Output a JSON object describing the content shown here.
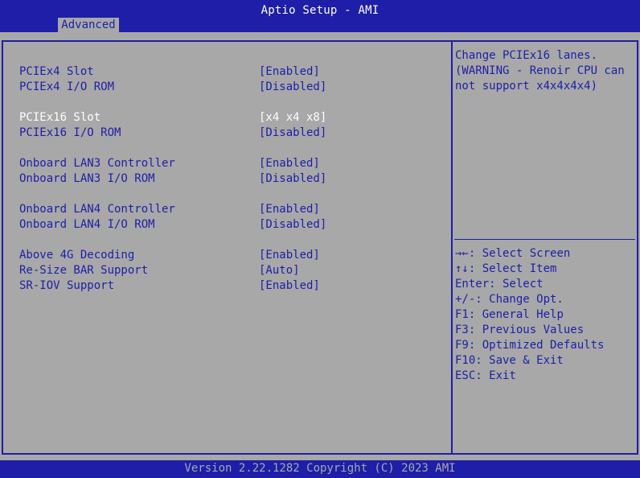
{
  "header": {
    "title": "Aptio Setup - AMI",
    "tabs": [
      {
        "label": "Advanced"
      }
    ]
  },
  "settings": [
    {
      "label": "PCIEx4 Slot",
      "value": "[Enabled]"
    },
    {
      "label": "PCIEx4 I/O ROM",
      "value": "[Disabled]"
    },
    {
      "label": "PCIEx16 Slot",
      "value": "[x4 x4 x8]",
      "selected": true
    },
    {
      "label": "PCIEx16 I/O ROM",
      "value": "[Disabled]"
    },
    {
      "label": "Onboard LAN3 Controller",
      "value": "[Enabled]"
    },
    {
      "label": "Onboard LAN3 I/O ROM",
      "value": "[Disabled]"
    },
    {
      "label": "Onboard LAN4 Controller",
      "value": "[Enabled]"
    },
    {
      "label": "Onboard LAN4 I/O ROM",
      "value": "[Disabled]"
    },
    {
      "label": "Above 4G Decoding",
      "value": "[Enabled]"
    },
    {
      "label": "Re-Size BAR Support",
      "value": "[Auto]"
    },
    {
      "label": "SR-IOV Support",
      "value": "[Enabled]"
    }
  ],
  "help": {
    "text": "Change PCIEx16 lanes.\n(WARNING - Renoir CPU can\nnot support x4x4x4x4)"
  },
  "keys": [
    {
      "key": "→←:",
      "desc": " Select Screen"
    },
    {
      "key": "↑↓:",
      "desc": " Select Item"
    },
    {
      "key": "Enter:",
      "desc": " Select"
    },
    {
      "key": "+/-:",
      "desc": " Change Opt."
    },
    {
      "key": "F1:",
      "desc": " General Help"
    },
    {
      "key": "F3:",
      "desc": " Previous Values"
    },
    {
      "key": "F9:",
      "desc": " Optimized Defaults"
    },
    {
      "key": "F10:",
      "desc": " Save & Exit"
    },
    {
      "key": "ESC:",
      "desc": " Exit"
    }
  ],
  "footer": {
    "version": "Version 2.22.1282 Copyright (C) 2023 AMI"
  },
  "colors": {
    "bios_blue": "#1e1ea8",
    "bios_gray": "#a8a8a8",
    "selected_text": "#ffffff"
  }
}
